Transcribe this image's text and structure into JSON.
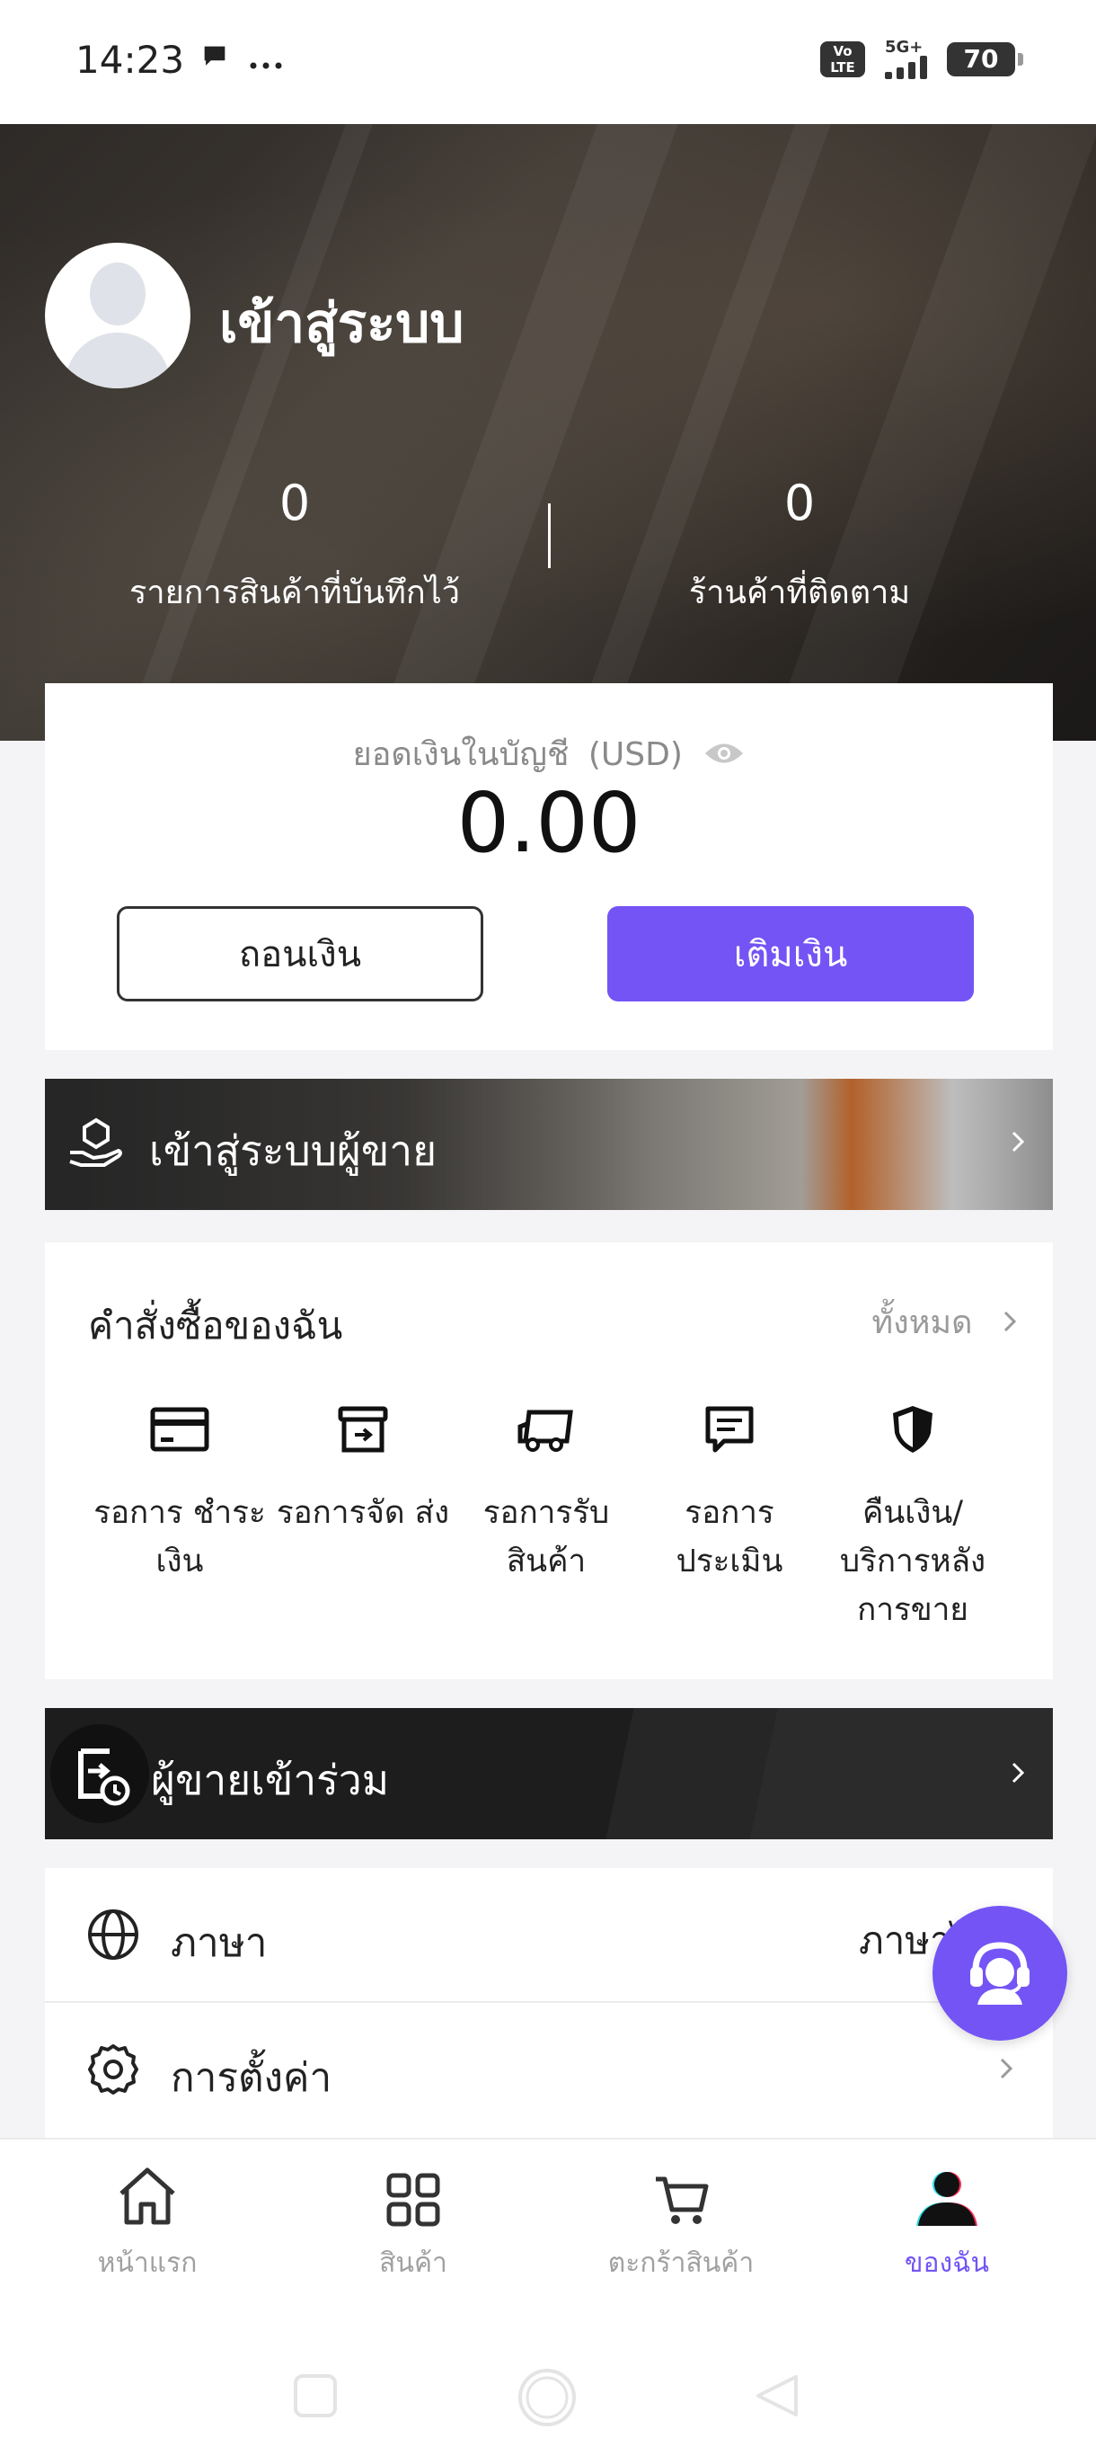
{
  "status_bar": {
    "time": "14:23",
    "left_icons": [
      "chat-bubble-icon",
      "more-dots-icon"
    ],
    "network": "5G+",
    "volte": "Vo LTE",
    "battery": "70"
  },
  "profile": {
    "login_title": "เข้าสู่ระบบ",
    "stats": [
      {
        "value": "0",
        "label": "รายการสินค้าที่บันทึกไว้"
      },
      {
        "value": "0",
        "label": "ร้านค้าที่ติดตาม"
      }
    ]
  },
  "balance": {
    "label": "ยอดเงินในบัญชี",
    "currency": "(USD)",
    "amount": "0.00",
    "withdraw_label": "ถอนเงิน",
    "deposit_label": "เติมเงิน"
  },
  "seller_login": {
    "label": "เข้าสู่ระบบผู้ขาย"
  },
  "orders": {
    "title": "คำสั่งซื้อของฉัน",
    "all_label": "ทั้งหมด",
    "items": [
      {
        "label": "รอการ ชำระเงิน",
        "icon": "payment-card-icon"
      },
      {
        "label": "รอการจัด ส่ง",
        "icon": "shipping-box-icon"
      },
      {
        "label": "รอการรับ สินค้า",
        "icon": "delivery-truck-icon"
      },
      {
        "label": "รอการ ประเมิน",
        "icon": "review-icon"
      },
      {
        "label": "คืนเงิน/ บริการหลัง การขาย",
        "icon": "refund-shield-icon"
      }
    ]
  },
  "seller_join": {
    "label": "ผู้ขายเข้าร่วม"
  },
  "settings": {
    "language_label": "ภาษา",
    "language_value": "ภาษาไทย",
    "settings_label": "การตั้งค่า"
  },
  "bottom_nav": {
    "items": [
      {
        "label": "หน้าแรก",
        "icon": "home-icon"
      },
      {
        "label": "สินค้า",
        "icon": "grid-icon"
      },
      {
        "label": "ตะกร้าสินค้า",
        "icon": "cart-icon"
      },
      {
        "label": "ของฉัน",
        "icon": "profile-icon",
        "active": true
      }
    ]
  },
  "colors": {
    "accent": "#7454f5"
  }
}
